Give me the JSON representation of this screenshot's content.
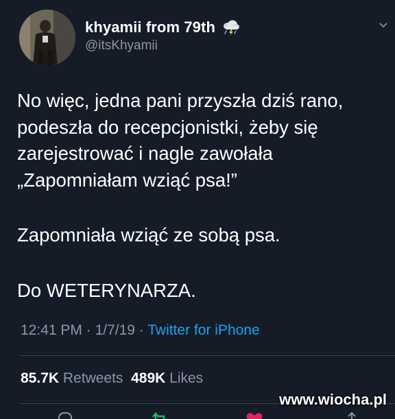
{
  "user": {
    "display_name": "khyamii from 79th",
    "handle": "@itsKhyamii",
    "status_icon": "thunder-cloud-icon"
  },
  "tweet": {
    "lines": [
      "No więc, jedna pani przyszła dziś rano,",
      "podeszła do recepcjonistki, żeby się",
      "zarejestrować i nagle zawołała",
      "„Zapomniałam wziąć psa!”",
      "Zapomniała wziąć ze sobą psa.",
      "Do WETERYNARZA."
    ],
    "time": "12:41 PM",
    "date": "1/7/19",
    "separator": " · ",
    "source": "Twitter for iPhone"
  },
  "stats": {
    "retweets_count": "85.7K",
    "retweets_label": "Retweets",
    "likes_count": "489K",
    "likes_label": "Likes"
  },
  "watermark": "www.wiocha.pl",
  "colors": {
    "background": "#151c28",
    "text": "#ffffff",
    "secondary": "#8899a6",
    "link": "#1da1f2",
    "retweet": "#17bf63",
    "like": "#e0245e"
  }
}
